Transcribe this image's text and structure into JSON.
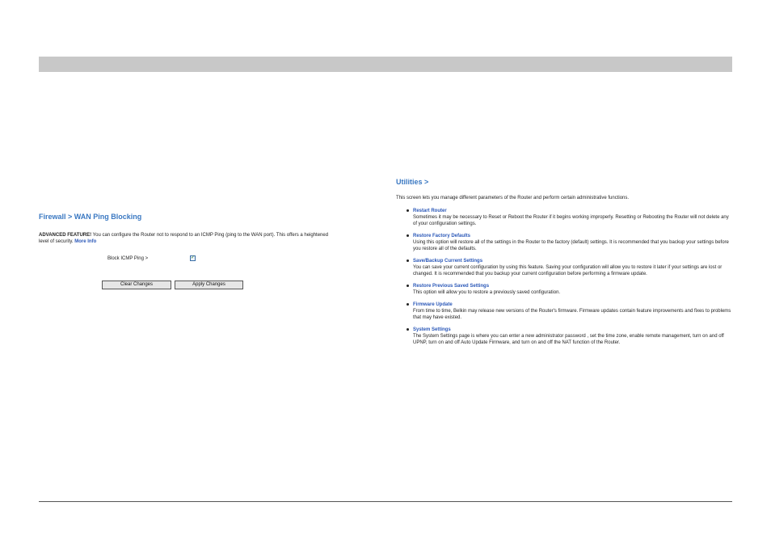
{
  "firewall": {
    "title": "Firewall > WAN Ping Blocking",
    "advanced_label": "ADVANCED FEATURE!",
    "advanced_text": " You can configure the Router not to respond to an ICMP Ping (ping to the WAN port). This offers a heightened level of security. ",
    "more_info": "More Info",
    "block_icmp_label": "Block ICMP Ping >",
    "block_icmp_checked": true,
    "check_glyph": "✓",
    "clear_button": "Clear Changes",
    "apply_button": "Apply Changes"
  },
  "utilities": {
    "title": "Utilities >",
    "intro": "This screen lets you manage different parameters of the Router and perform certain administrative functions.",
    "items": [
      {
        "title": "Restart Router",
        "desc": "Sometimes it may be necessary to Reset or Reboot the Router if it begins working improperly. Resetting or Rebooting the Router will not delete any of your configuration settings."
      },
      {
        "title": "Restore Factory Defaults",
        "desc": "Using this option will restore all of the settings in the Router to the factory (default) settings. It is recommended that you backup your settings before you restore all of the defaults."
      },
      {
        "title": "Save/Backup Current Settings",
        "desc": "You can save your current configuration by using this feature. Saving your configuration will allow you to restore it later if your settings are lost or changed. It is recommended that you backup your current configuration before performing a firmware update."
      },
      {
        "title": "Restore Previous Saved Settings",
        "desc": "This option will allow you to restore a previously saved configuration."
      },
      {
        "title": "Firmware Update",
        "desc": "From time to time, Belkin may release new versions of the Router's firmware. Firmware updates contain feature improvements and fixes to problems that may have existed."
      },
      {
        "title": "System Settings",
        "desc": "The System Settings page is where you can enter a new administrator password , set the time zone, enable remote management, turn on and off UPNP, turn on and off Auto Update Firmware, and turn on and off the NAT function of the Router."
      }
    ]
  },
  "colors": {
    "header_bar": "#c8c8c8",
    "title_blue": "#3a78c2",
    "link_blue": "#2b58b8"
  }
}
